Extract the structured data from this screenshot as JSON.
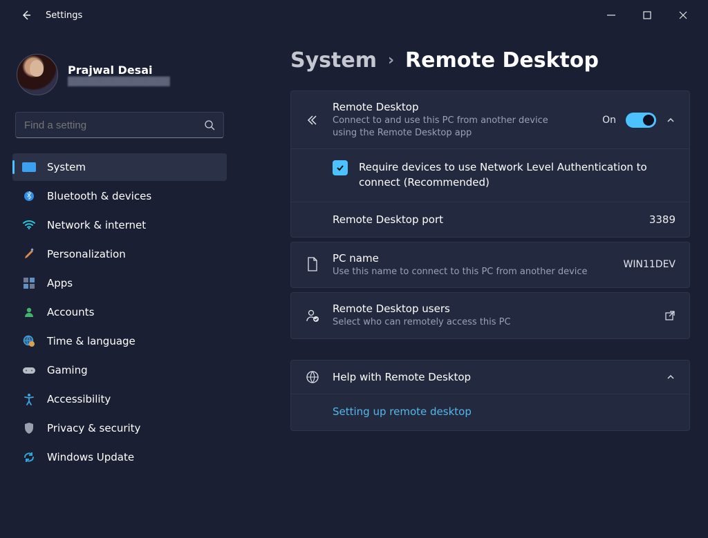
{
  "window": {
    "title": "Settings"
  },
  "user": {
    "name": "Prajwal Desai",
    "sub": "████████████████"
  },
  "search": {
    "placeholder": "Find a setting"
  },
  "nav": [
    {
      "id": "system",
      "label": "System",
      "icon": "display-icon",
      "active": true
    },
    {
      "id": "bluetooth",
      "label": "Bluetooth & devices",
      "icon": "bluetooth-icon",
      "active": false
    },
    {
      "id": "network",
      "label": "Network & internet",
      "icon": "wifi-icon",
      "active": false
    },
    {
      "id": "personalization",
      "label": "Personalization",
      "icon": "paintbrush-icon",
      "active": false
    },
    {
      "id": "apps",
      "label": "Apps",
      "icon": "apps-icon",
      "active": false
    },
    {
      "id": "accounts",
      "label": "Accounts",
      "icon": "person-icon",
      "active": false
    },
    {
      "id": "time",
      "label": "Time & language",
      "icon": "globe-clock-icon",
      "active": false
    },
    {
      "id": "gaming",
      "label": "Gaming",
      "icon": "gamepad-icon",
      "active": false
    },
    {
      "id": "accessibility",
      "label": "Accessibility",
      "icon": "accessibility-icon",
      "active": false
    },
    {
      "id": "privacy",
      "label": "Privacy & security",
      "icon": "shield-icon",
      "active": false
    },
    {
      "id": "update",
      "label": "Windows Update",
      "icon": "update-icon",
      "active": false
    }
  ],
  "breadcrumb": {
    "parent": "System",
    "separator": "›",
    "current": "Remote Desktop"
  },
  "rd_main": {
    "title": "Remote Desktop",
    "sub": "Connect to and use this PC from another device using the Remote Desktop app",
    "state_label": "On",
    "state_on": true,
    "nla_label": "Require devices to use Network Level Authentication to connect (Recommended)",
    "nla_checked": true,
    "port_label": "Remote Desktop port",
    "port_value": "3389"
  },
  "pcname": {
    "title": "PC name",
    "sub": "Use this name to connect to this PC from another device",
    "value": "WIN11DEV"
  },
  "rd_users": {
    "title": "Remote Desktop users",
    "sub": "Select who can remotely access this PC"
  },
  "help": {
    "title": "Help with Remote Desktop",
    "link": "Setting up remote desktop"
  }
}
